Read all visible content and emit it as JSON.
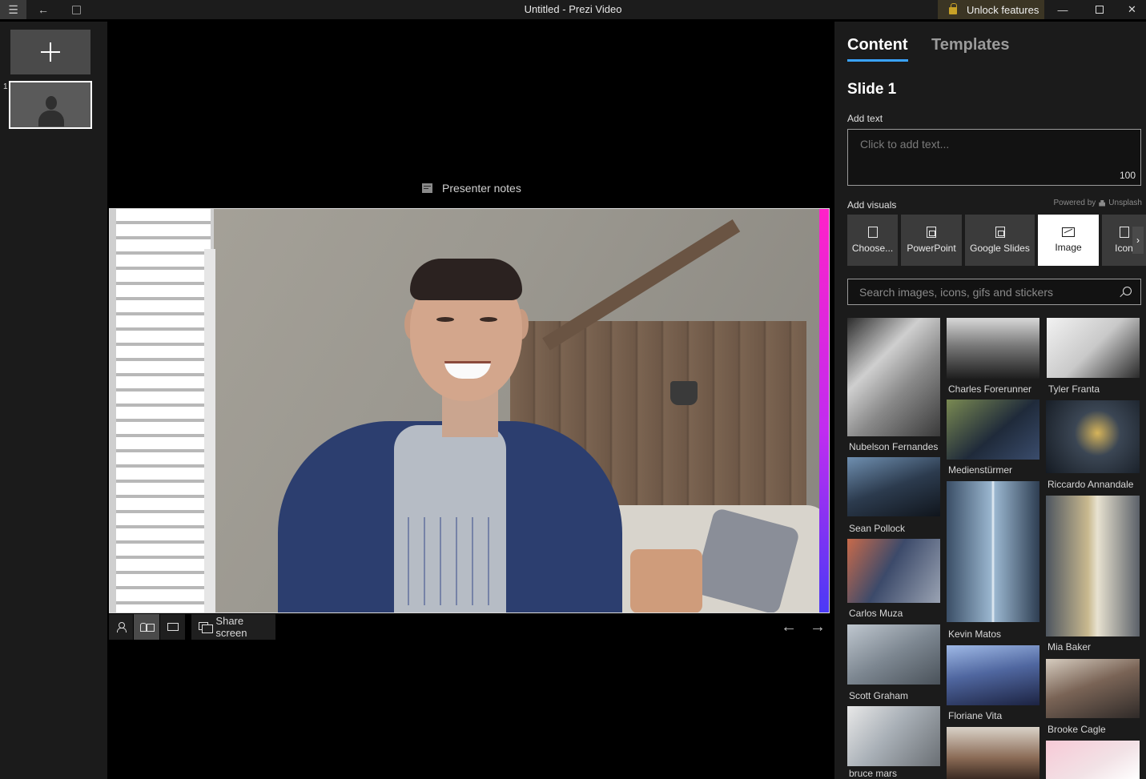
{
  "titlebar": {
    "title": "Untitled  -  Prezi Video",
    "unlock_label": "Unlock features"
  },
  "slides": {
    "items": [
      {
        "number": "1"
      }
    ]
  },
  "stage": {
    "presenter_notes_label": "Presenter notes",
    "share_screen_label": "Share screen"
  },
  "panel": {
    "tabs": [
      {
        "label": "Content",
        "active": true
      },
      {
        "label": "Templates",
        "active": false
      }
    ],
    "slide_title": "Slide 1",
    "add_text_label": "Add text",
    "text_placeholder": "Click to add text...",
    "text_limit": "100",
    "add_visuals_label": "Add visuals",
    "powered_by": "Powered by",
    "powered_brand": "Unsplash",
    "visual_buttons": [
      {
        "label": "Choose...",
        "icon": "book-icon"
      },
      {
        "label": "PowerPoint",
        "icon": "powerpoint-icon"
      },
      {
        "label": "Google Slides",
        "icon": "slides-icon"
      },
      {
        "label": "Image",
        "icon": "image-icon",
        "selected": true
      },
      {
        "label": "Icon",
        "icon": "icon-icon"
      }
    ],
    "search_placeholder": "Search images, icons, gifs and stickers",
    "photos": [
      {
        "credit": "Nubelson Fernandes"
      },
      {
        "credit": "Charles Forerunner"
      },
      {
        "credit": "Tyler Franta"
      },
      {
        "credit": "Medienstürmer"
      },
      {
        "credit": "Riccardo Annandale"
      },
      {
        "credit": "Sean Pollock"
      },
      {
        "credit": "Kevin Matos"
      },
      {
        "credit": "Mia Baker"
      },
      {
        "credit": "Carlos Muza"
      },
      {
        "credit": "Scott Graham"
      },
      {
        "credit": "Floriane Vita"
      },
      {
        "credit": "Brooke Cagle"
      },
      {
        "credit": "bruce mars"
      }
    ]
  },
  "colors": {
    "accent": "#3aa3ff",
    "brand_gradient_top": "#ff22c8",
    "brand_gradient_bottom": "#4a3af5"
  }
}
